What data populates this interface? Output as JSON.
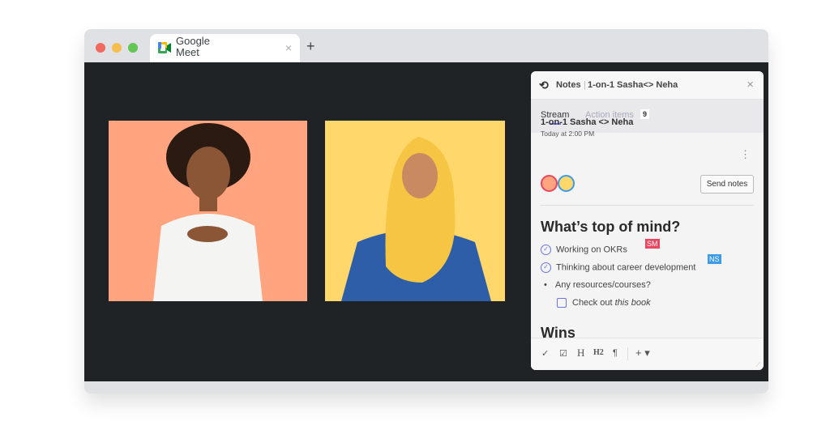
{
  "browser": {
    "tab_title": "Google Meet",
    "new_tab": "+",
    "close_tab": "×"
  },
  "panel": {
    "app": "Notes",
    "title": "1-on-1 Sasha<> Neha",
    "close": "×",
    "tabs": [
      {
        "label": "Stream",
        "active": true
      },
      {
        "label": "Action items",
        "badge": "9"
      }
    ],
    "meeting": {
      "title": "1-on-1 Sasha <> Neha",
      "time": "Today at 2:00 PM",
      "send_label": "Send notes",
      "more": "⋮"
    },
    "heading": "What’s top of mind?",
    "items": [
      {
        "text": "Working on OKRs",
        "type": "done",
        "cursor": "SM",
        "cursor_color": "#e8475f"
      },
      {
        "text": "Thinking about career development",
        "type": "done",
        "cursor": "NS",
        "cursor_color": "#3b9be8"
      },
      {
        "text": "Any resources/courses?",
        "type": "bullet"
      },
      {
        "text": "Check out ",
        "italic": "this book",
        "type": "todo"
      }
    ],
    "heading2": "Wins",
    "toolbar": [
      "✓",
      "☑",
      "H",
      "H2",
      "¶",
      "+ ▾"
    ]
  },
  "colors": {
    "tile1": "#ffa47e",
    "tile2": "#ffd76a",
    "accent": "#6b73e6"
  }
}
